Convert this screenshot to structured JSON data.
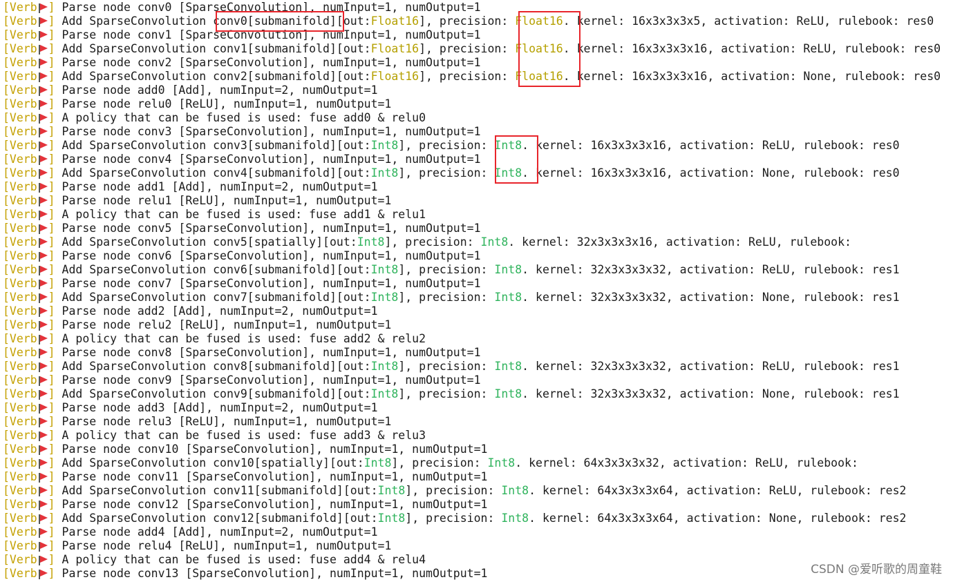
{
  "terminal": {
    "level_prefix": "[Verb",
    "level_suffix": "]",
    "lines": [
      [
        {
          "t": "Parse node conv0 [SparseConvolution], numInput=1, numOutput=1"
        }
      ],
      [
        {
          "t": "Add SparseConvolution conv0[submanifold][out:"
        },
        {
          "t": "Float16",
          "c": "fp16"
        },
        {
          "t": "], precision: "
        },
        {
          "t": "Float16",
          "c": "fp16"
        },
        {
          "t": ". kernel: 16x3x3x3x5, activation: ReLU, rulebook: res0"
        }
      ],
      [
        {
          "t": "Parse node conv1 [SparseConvolution], numInput=1, numOutput=1"
        }
      ],
      [
        {
          "t": "Add SparseConvolution conv1[submanifold][out:"
        },
        {
          "t": "Float16",
          "c": "fp16"
        },
        {
          "t": "], precision: "
        },
        {
          "t": "Float16",
          "c": "fp16"
        },
        {
          "t": ". kernel: 16x3x3x3x16, activation: ReLU, rulebook: res0"
        }
      ],
      [
        {
          "t": "Parse node conv2 [SparseConvolution], numInput=1, numOutput=1"
        }
      ],
      [
        {
          "t": "Add SparseConvolution conv2[submanifold][out:"
        },
        {
          "t": "Float16",
          "c": "fp16"
        },
        {
          "t": "], precision: "
        },
        {
          "t": "Float16",
          "c": "fp16"
        },
        {
          "t": ". kernel: 16x3x3x3x16, activation: None, rulebook: res0"
        }
      ],
      [
        {
          "t": "Parse node add0 [Add], numInput=2, numOutput=1"
        }
      ],
      [
        {
          "t": "Parse node relu0 [ReLU], numInput=1, numOutput=1"
        }
      ],
      [
        {
          "t": "A policy that can be fused is used: fuse add0 & relu0"
        }
      ],
      [
        {
          "t": "Parse node conv3 [SparseConvolution], numInput=1, numOutput=1"
        }
      ],
      [
        {
          "t": "Add SparseConvolution conv3[submanifold][out:"
        },
        {
          "t": "Int8",
          "c": "int8"
        },
        {
          "t": "], precision: "
        },
        {
          "t": "Int8",
          "c": "int8"
        },
        {
          "t": ". kernel: 16x3x3x3x16, activation: ReLU, rulebook: res0"
        }
      ],
      [
        {
          "t": "Parse node conv4 [SparseConvolution], numInput=1, numOutput=1"
        }
      ],
      [
        {
          "t": "Add SparseConvolution conv4[submanifold][out:"
        },
        {
          "t": "Int8",
          "c": "int8"
        },
        {
          "t": "], precision: "
        },
        {
          "t": "Int8",
          "c": "int8"
        },
        {
          "t": ". kernel: 16x3x3x3x16, activation: None, rulebook: res0"
        }
      ],
      [
        {
          "t": "Parse node add1 [Add], numInput=2, numOutput=1"
        }
      ],
      [
        {
          "t": "Parse node relu1 [ReLU], numInput=1, numOutput=1"
        }
      ],
      [
        {
          "t": "A policy that can be fused is used: fuse add1 & relu1"
        }
      ],
      [
        {
          "t": "Parse node conv5 [SparseConvolution], numInput=1, numOutput=1"
        }
      ],
      [
        {
          "t": "Add SparseConvolution conv5[spatially][out:"
        },
        {
          "t": "Int8",
          "c": "int8"
        },
        {
          "t": "], precision: "
        },
        {
          "t": "Int8",
          "c": "int8"
        },
        {
          "t": ". kernel: 32x3x3x3x16, activation: ReLU, rulebook:"
        }
      ],
      [
        {
          "t": "Parse node conv6 [SparseConvolution], numInput=1, numOutput=1"
        }
      ],
      [
        {
          "t": "Add SparseConvolution conv6[submanifold][out:"
        },
        {
          "t": "Int8",
          "c": "int8"
        },
        {
          "t": "], precision: "
        },
        {
          "t": "Int8",
          "c": "int8"
        },
        {
          "t": ". kernel: 32x3x3x3x32, activation: ReLU, rulebook: res1"
        }
      ],
      [
        {
          "t": "Parse node conv7 [SparseConvolution], numInput=1, numOutput=1"
        }
      ],
      [
        {
          "t": "Add SparseConvolution conv7[submanifold][out:"
        },
        {
          "t": "Int8",
          "c": "int8"
        },
        {
          "t": "], precision: "
        },
        {
          "t": "Int8",
          "c": "int8"
        },
        {
          "t": ". kernel: 32x3x3x3x32, activation: None, rulebook: res1"
        }
      ],
      [
        {
          "t": "Parse node add2 [Add], numInput=2, numOutput=1"
        }
      ],
      [
        {
          "t": "Parse node relu2 [ReLU], numInput=1, numOutput=1"
        }
      ],
      [
        {
          "t": "A policy that can be fused is used: fuse add2 & relu2"
        }
      ],
      [
        {
          "t": "Parse node conv8 [SparseConvolution], numInput=1, numOutput=1"
        }
      ],
      [
        {
          "t": "Add SparseConvolution conv8[submanifold][out:"
        },
        {
          "t": "Int8",
          "c": "int8"
        },
        {
          "t": "], precision: "
        },
        {
          "t": "Int8",
          "c": "int8"
        },
        {
          "t": ". kernel: 32x3x3x3x32, activation: ReLU, rulebook: res1"
        }
      ],
      [
        {
          "t": "Parse node conv9 [SparseConvolution], numInput=1, numOutput=1"
        }
      ],
      [
        {
          "t": "Add SparseConvolution conv9[submanifold][out:"
        },
        {
          "t": "Int8",
          "c": "int8"
        },
        {
          "t": "], precision: "
        },
        {
          "t": "Int8",
          "c": "int8"
        },
        {
          "t": ". kernel: 32x3x3x3x32, activation: None, rulebook: res1"
        }
      ],
      [
        {
          "t": "Parse node add3 [Add], numInput=2, numOutput=1"
        }
      ],
      [
        {
          "t": "Parse node relu3 [ReLU], numInput=1, numOutput=1"
        }
      ],
      [
        {
          "t": "A policy that can be fused is used: fuse add3 & relu3"
        }
      ],
      [
        {
          "t": "Parse node conv10 [SparseConvolution], numInput=1, numOutput=1"
        }
      ],
      [
        {
          "t": "Add SparseConvolution conv10[spatially][out:"
        },
        {
          "t": "Int8",
          "c": "int8"
        },
        {
          "t": "], precision: "
        },
        {
          "t": "Int8",
          "c": "int8"
        },
        {
          "t": ". kernel: 64x3x3x3x32, activation: ReLU, rulebook:"
        }
      ],
      [
        {
          "t": "Parse node conv11 [SparseConvolution], numInput=1, numOutput=1"
        }
      ],
      [
        {
          "t": "Add SparseConvolution conv11[submanifold][out:"
        },
        {
          "t": "Int8",
          "c": "int8"
        },
        {
          "t": "], precision: "
        },
        {
          "t": "Int8",
          "c": "int8"
        },
        {
          "t": ". kernel: 64x3x3x3x64, activation: ReLU, rulebook: res2"
        }
      ],
      [
        {
          "t": "Parse node conv12 [SparseConvolution], numInput=1, numOutput=1"
        }
      ],
      [
        {
          "t": "Add SparseConvolution conv12[submanifold][out:"
        },
        {
          "t": "Int8",
          "c": "int8"
        },
        {
          "t": "], precision: "
        },
        {
          "t": "Int8",
          "c": "int8"
        },
        {
          "t": ". kernel: 64x3x3x3x64, activation: None, rulebook: res2"
        }
      ],
      [
        {
          "t": "Parse node add4 [Add], numInput=2, numOutput=1"
        }
      ],
      [
        {
          "t": "Parse node relu4 [ReLU], numInput=1, numOutput=1"
        }
      ],
      [
        {
          "t": "A policy that can be fused is used: fuse add4 & relu4"
        }
      ],
      [
        {
          "t": "Parse node conv13 [SparseConvolution], numInput=1, numOutput=1"
        }
      ]
    ]
  },
  "icons": {
    "level_flag": "red-flag-icon"
  },
  "colors": {
    "level": "#c4a000",
    "float16": "#b5a000",
    "int8": "#2fb35c",
    "highlight_box": "#e8242a"
  },
  "watermark": "CSDN @爱听歌的周童鞋"
}
